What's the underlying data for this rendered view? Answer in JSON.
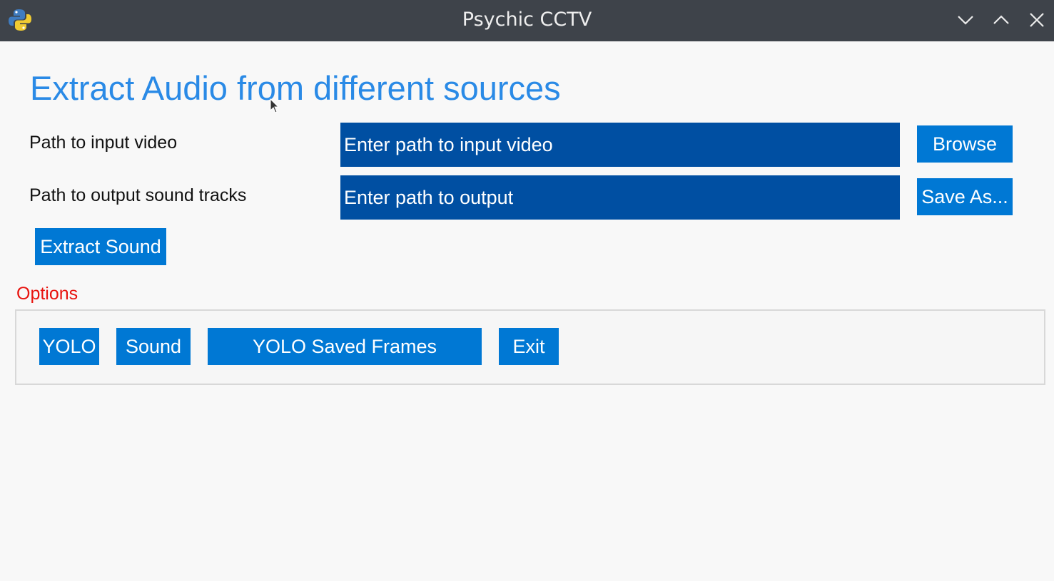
{
  "window": {
    "title": "Psychic CCTV",
    "icon": "python-icon"
  },
  "heading": "Extract Audio from different sources",
  "input_video": {
    "label": "Path to input video",
    "placeholder": "Enter path to input video",
    "value": "",
    "button_label": "Browse"
  },
  "output_tracks": {
    "label": "Path to output sound tracks",
    "placeholder": "Enter path to output",
    "value": "",
    "button_label": "Save As..."
  },
  "extract_button": "Extract Sound",
  "options": {
    "label": "Options",
    "buttons": [
      "YOLO",
      "Sound",
      "YOLO Saved Frames",
      "Exit"
    ]
  },
  "colors": {
    "titlebar": "#3e434a",
    "heading": "#2a8ae6",
    "input_bg": "#004fa2",
    "button_bg": "#0078d4",
    "options_label": "#e8130e"
  }
}
